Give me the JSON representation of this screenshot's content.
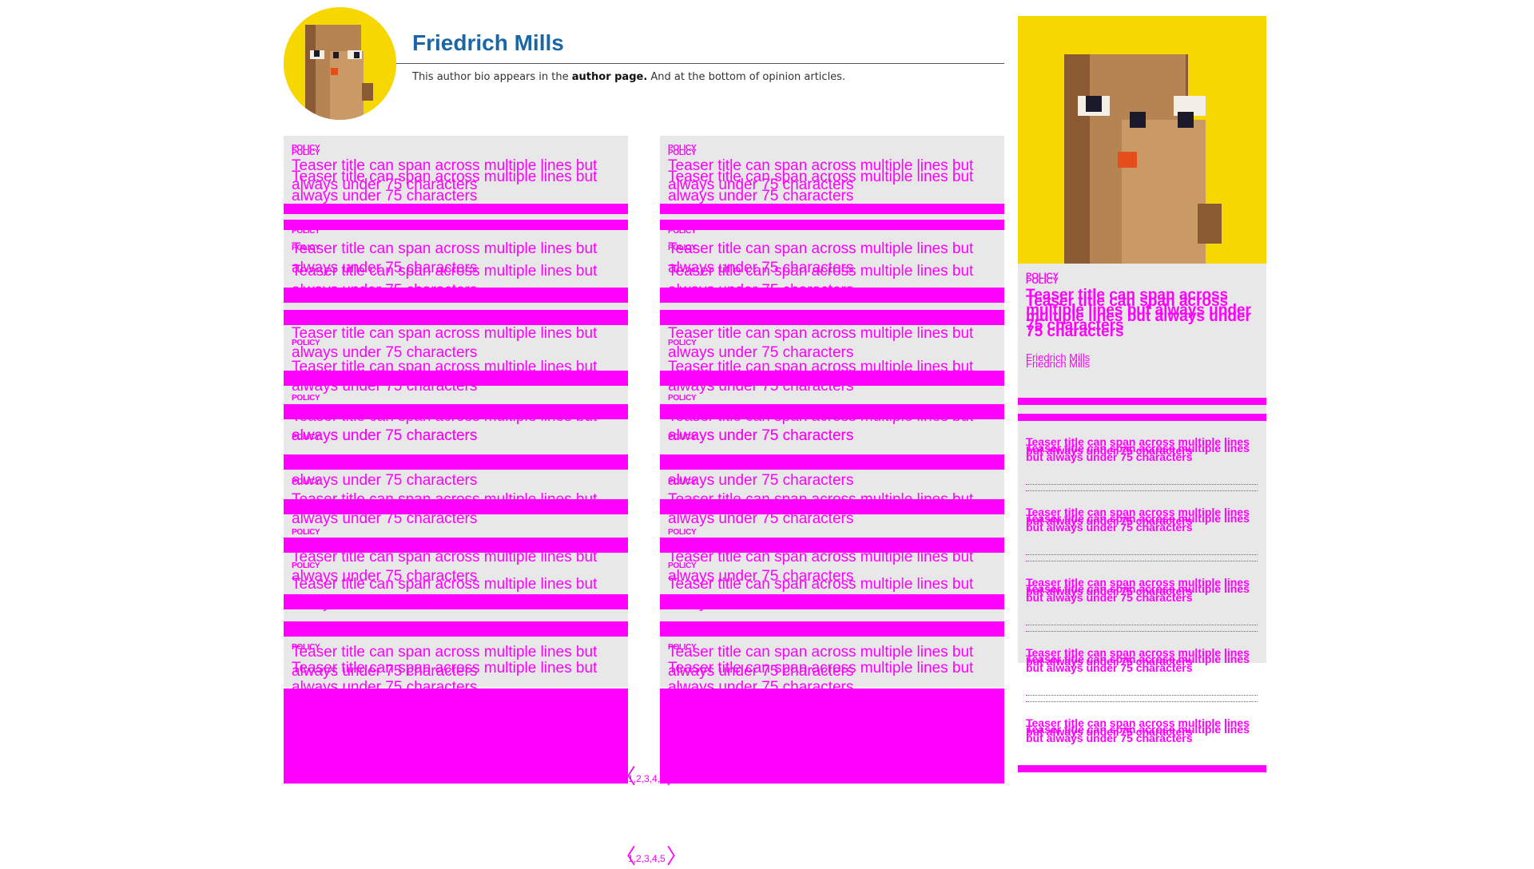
{
  "author": {
    "name": "Friedrich Mills",
    "bio_prefix": "This author bio appears in the ",
    "bio_link": "author page.",
    "bio_suffix": " And at the bottom of opinion articles."
  },
  "teaser": {
    "category": "POLICY",
    "title": "Teaser title can span across multiple lines but always under 75 characters",
    "title_partial": "always under 75 characters"
  },
  "rail": {
    "category": "POLICY",
    "title": "Teaser title can span across multiple lines but always under 75 characters",
    "byline": "Friedrich Mills",
    "list_item": "Teaser title can span across multiple lines but always under 75 characters"
  },
  "pagination": {
    "pages": "1,2,3,4,5",
    "prev_icon": "chevron-left-icon",
    "next_icon": "chevron-right-icon"
  },
  "colors": {
    "author_name": "#1a66a6",
    "placeholder": "#ff00ff",
    "card_bg": "#e8e8e8",
    "hero_bg": "#f7d700"
  }
}
